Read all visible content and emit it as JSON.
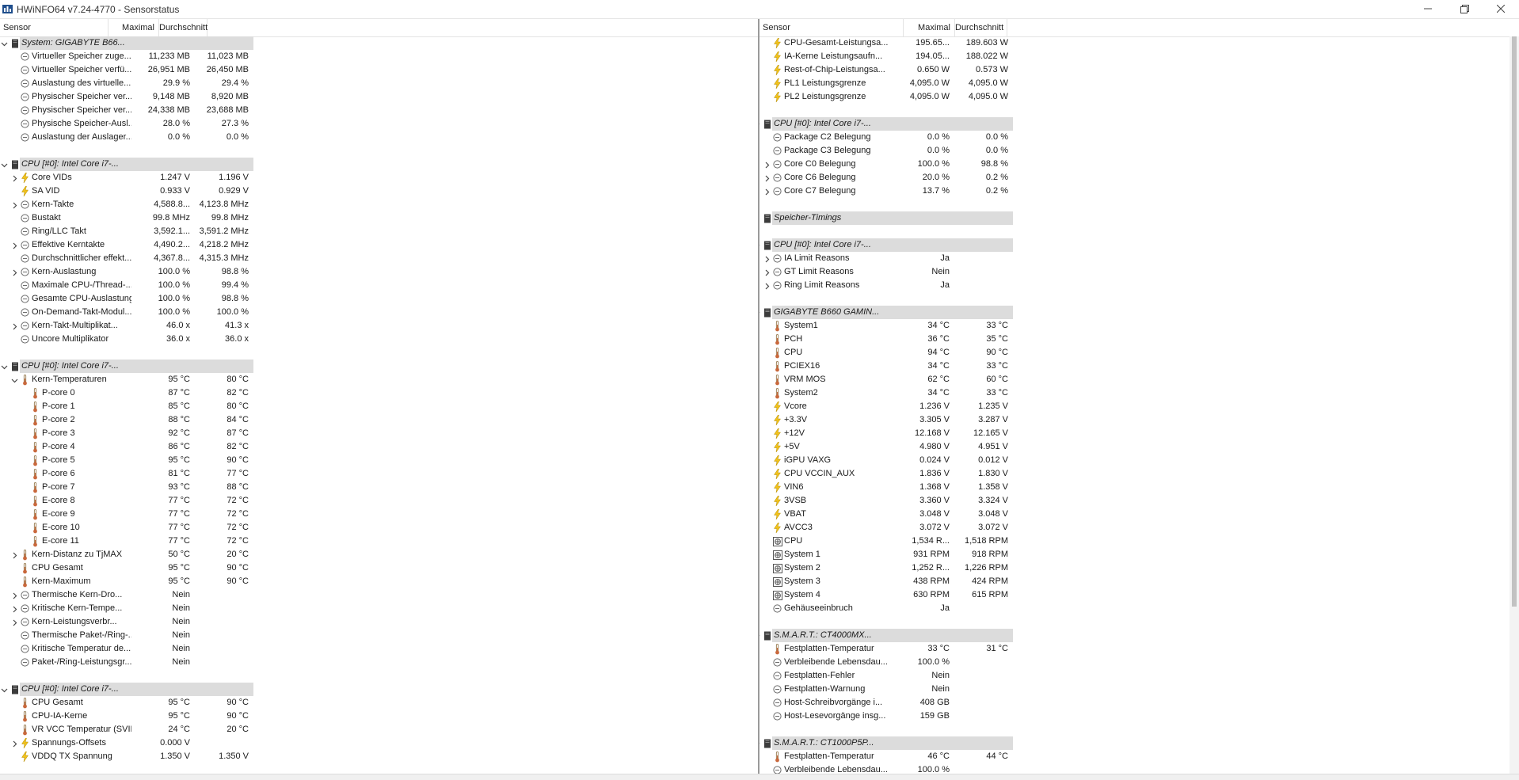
{
  "window": {
    "title": "HWiNFO64 v7.24-4770 - Sensorstatus"
  },
  "columns": {
    "sensor": "Sensor",
    "max": "Maximal",
    "avg": "Durchschnitt"
  },
  "left_rows": [
    {
      "g": 1,
      "e": "v",
      "i": "chip",
      "l": "System: GIGABYTE B66..."
    },
    {
      "d": 1,
      "i": "circle",
      "l": "Virtueller Speicher zuge...",
      "m": "11,233 MB",
      "a": "11,023 MB"
    },
    {
      "d": 1,
      "i": "circle",
      "l": "Virtueller Speicher verfü...",
      "m": "26,951 MB",
      "a": "26,450 MB"
    },
    {
      "d": 1,
      "i": "circle",
      "l": "Auslastung des virtuelle...",
      "m": "29.9 %",
      "a": "29.4 %"
    },
    {
      "d": 1,
      "i": "circle",
      "l": "Physischer Speicher ver...",
      "m": "9,148 MB",
      "a": "8,920 MB"
    },
    {
      "d": 1,
      "i": "circle",
      "l": "Physischer Speicher ver...",
      "m": "24,338 MB",
      "a": "23,688 MB"
    },
    {
      "d": 1,
      "i": "circle",
      "l": "Physische Speicher-Ausl...",
      "m": "28.0 %",
      "a": "27.3 %"
    },
    {
      "d": 1,
      "i": "circle",
      "l": "Auslastung der Auslager...",
      "m": "0.0 %",
      "a": "0.0 %"
    },
    {
      "b": 1
    },
    {
      "g": 1,
      "e": "v",
      "i": "chip",
      "l": "CPU [#0]: Intel Core i7-..."
    },
    {
      "d": 1,
      "e": ">",
      "i": "bolt",
      "l": "Core VIDs",
      "m": "1.247 V",
      "a": "1.196 V"
    },
    {
      "d": 1,
      "i": "bolt",
      "l": "SA VID",
      "m": "0.933 V",
      "a": "0.929 V"
    },
    {
      "d": 1,
      "e": ">",
      "i": "circle",
      "l": "Kern-Takte",
      "m": "4,588.8...",
      "a": "4,123.8 MHz"
    },
    {
      "d": 1,
      "i": "circle",
      "l": "Bustakt",
      "m": "99.8 MHz",
      "a": "99.8 MHz"
    },
    {
      "d": 1,
      "i": "circle",
      "l": "Ring/LLC Takt",
      "m": "3,592.1...",
      "a": "3,591.2 MHz"
    },
    {
      "d": 1,
      "e": ">",
      "i": "circle",
      "l": "Effektive Kerntakte",
      "m": "4,490.2...",
      "a": "4,218.2 MHz"
    },
    {
      "d": 1,
      "i": "circle",
      "l": "Durchschnittlicher effekt...",
      "m": "4,367.8...",
      "a": "4,315.3 MHz"
    },
    {
      "d": 1,
      "e": ">",
      "i": "circle",
      "l": "Kern-Auslastung",
      "m": "100.0 %",
      "a": "98.8 %"
    },
    {
      "d": 1,
      "i": "circle",
      "l": "Maximale CPU-/Thread-...",
      "m": "100.0 %",
      "a": "99.4 %"
    },
    {
      "d": 1,
      "i": "circle",
      "l": "Gesamte CPU-Auslastung",
      "m": "100.0 %",
      "a": "98.8 %"
    },
    {
      "d": 1,
      "i": "circle",
      "l": "On-Demand-Takt-Modul...",
      "m": "100.0 %",
      "a": "100.0 %"
    },
    {
      "d": 1,
      "e": ">",
      "i": "circle",
      "l": "Kern-Takt-Multiplikat...",
      "m": "46.0 x",
      "a": "41.3 x"
    },
    {
      "d": 1,
      "i": "circle",
      "l": "Uncore Multiplikator",
      "m": "36.0 x",
      "a": "36.0 x"
    },
    {
      "b": 1
    },
    {
      "g": 1,
      "e": "v",
      "i": "chip",
      "l": "CPU [#0]: Intel Core i7-..."
    },
    {
      "d": 1,
      "e": "v",
      "i": "therm",
      "l": "Kern-Temperaturen",
      "m": "95 °C",
      "a": "80 °C"
    },
    {
      "d": 2,
      "i": "therm",
      "l": "P-core 0",
      "m": "87 °C",
      "a": "82 °C"
    },
    {
      "d": 2,
      "i": "therm",
      "l": "P-core 1",
      "m": "85 °C",
      "a": "80 °C"
    },
    {
      "d": 2,
      "i": "therm",
      "l": "P-core 2",
      "m": "88 °C",
      "a": "84 °C"
    },
    {
      "d": 2,
      "i": "therm",
      "l": "P-core 3",
      "m": "92 °C",
      "a": "87 °C"
    },
    {
      "d": 2,
      "i": "therm",
      "l": "P-core 4",
      "m": "86 °C",
      "a": "82 °C"
    },
    {
      "d": 2,
      "i": "therm",
      "l": "P-core 5",
      "m": "95 °C",
      "a": "90 °C"
    },
    {
      "d": 2,
      "i": "therm",
      "l": "P-core 6",
      "m": "81 °C",
      "a": "77 °C"
    },
    {
      "d": 2,
      "i": "therm",
      "l": "P-core 7",
      "m": "93 °C",
      "a": "88 °C"
    },
    {
      "d": 2,
      "i": "therm",
      "l": "E-core 8",
      "m": "77 °C",
      "a": "72 °C"
    },
    {
      "d": 2,
      "i": "therm",
      "l": "E-core 9",
      "m": "77 °C",
      "a": "72 °C"
    },
    {
      "d": 2,
      "i": "therm",
      "l": "E-core 10",
      "m": "77 °C",
      "a": "72 °C"
    },
    {
      "d": 2,
      "i": "therm",
      "l": "E-core 11",
      "m": "77 °C",
      "a": "72 °C"
    },
    {
      "d": 1,
      "e": ">",
      "i": "therm",
      "l": "Kern-Distanz zu TjMAX",
      "m": "50 °C",
      "a": "20 °C"
    },
    {
      "d": 1,
      "i": "therm",
      "l": "CPU Gesamt",
      "m": "95 °C",
      "a": "90 °C"
    },
    {
      "d": 1,
      "i": "therm",
      "l": "Kern-Maximum",
      "m": "95 °C",
      "a": "90 °C"
    },
    {
      "d": 1,
      "e": ">",
      "i": "circle",
      "l": "Thermische Kern-Dro...",
      "m": "Nein",
      "a": ""
    },
    {
      "d": 1,
      "e": ">",
      "i": "circle",
      "l": "Kritische Kern-Tempe...",
      "m": "Nein",
      "a": ""
    },
    {
      "d": 1,
      "e": ">",
      "i": "circle",
      "l": "Kern-Leistungsverbr...",
      "m": "Nein",
      "a": ""
    },
    {
      "d": 1,
      "i": "circle",
      "l": "Thermische Paket-/Ring-...",
      "m": "Nein",
      "a": ""
    },
    {
      "d": 1,
      "i": "circle",
      "l": "Kritische Temperatur de...",
      "m": "Nein",
      "a": ""
    },
    {
      "d": 1,
      "i": "circle",
      "l": "Paket-/Ring-Leistungsgr...",
      "m": "Nein",
      "a": ""
    },
    {
      "b": 1
    },
    {
      "g": 1,
      "e": "v",
      "i": "chip",
      "l": "CPU [#0]: Intel Core i7-..."
    },
    {
      "d": 1,
      "i": "therm",
      "l": "CPU Gesamt",
      "m": "95 °C",
      "a": "90 °C"
    },
    {
      "d": 1,
      "i": "therm",
      "l": "CPU-IA-Kerne",
      "m": "95 °C",
      "a": "90 °C"
    },
    {
      "d": 1,
      "i": "therm",
      "l": "VR VCC Temperatur (SVID)",
      "m": "24 °C",
      "a": "20 °C"
    },
    {
      "d": 1,
      "e": ">",
      "i": "bolt",
      "l": "Spannungs-Offsets",
      "m": "0.000 V",
      "a": ""
    },
    {
      "d": 1,
      "i": "bolt",
      "l": "VDDQ TX Spannung",
      "m": "1.350 V",
      "a": "1.350 V"
    }
  ],
  "right_rows": [
    {
      "d": 1,
      "i": "bolt",
      "l": "CPU-Gesamt-Leistungsa...",
      "m": "195.65...",
      "a": "189.603 W"
    },
    {
      "d": 1,
      "i": "bolt",
      "l": "IA-Kerne Leistungsaufn...",
      "m": "194.05...",
      "a": "188.022 W"
    },
    {
      "d": 1,
      "i": "bolt",
      "l": "Rest-of-Chip-Leistungsa...",
      "m": "0.650 W",
      "a": "0.573 W"
    },
    {
      "d": 1,
      "i": "bolt",
      "l": "PL1 Leistungsgrenze",
      "m": "4,095.0 W",
      "a": "4,095.0 W"
    },
    {
      "d": 1,
      "i": "bolt",
      "l": "PL2 Leistungsgrenze",
      "m": "4,095.0 W",
      "a": "4,095.0 W"
    },
    {
      "b": 1
    },
    {
      "g": 1,
      "e": "v",
      "i": "chip",
      "l": "CPU [#0]: Intel Core i7-..."
    },
    {
      "d": 1,
      "i": "circle",
      "l": "Package C2 Belegung",
      "m": "0.0 %",
      "a": "0.0 %"
    },
    {
      "d": 1,
      "i": "circle",
      "l": "Package C3 Belegung",
      "m": "0.0 %",
      "a": "0.0 %"
    },
    {
      "d": 1,
      "e": ">",
      "i": "circle",
      "l": "Core C0 Belegung",
      "m": "100.0 %",
      "a": "98.8 %"
    },
    {
      "d": 1,
      "e": ">",
      "i": "circle",
      "l": "Core C6 Belegung",
      "m": "20.0 %",
      "a": "0.2 %"
    },
    {
      "d": 1,
      "e": ">",
      "i": "circle",
      "l": "Core C7 Belegung",
      "m": "13.7 %",
      "a": "0.2 %"
    },
    {
      "b": 1
    },
    {
      "g": 1,
      "e": ">",
      "i": "chip",
      "l": "Speicher-Timings"
    },
    {
      "b": 1
    },
    {
      "g": 1,
      "e": "v",
      "i": "chip",
      "l": "CPU [#0]: Intel Core i7-..."
    },
    {
      "d": 1,
      "e": ">",
      "i": "circle",
      "l": "IA Limit Reasons",
      "m": "Ja",
      "a": ""
    },
    {
      "d": 1,
      "e": ">",
      "i": "circle",
      "l": "GT Limit Reasons",
      "m": "Nein",
      "a": ""
    },
    {
      "d": 1,
      "e": ">",
      "i": "circle",
      "l": "Ring Limit Reasons",
      "m": "Ja",
      "a": ""
    },
    {
      "b": 1
    },
    {
      "g": 1,
      "e": "v",
      "i": "chip",
      "l": "GIGABYTE B660 GAMIN..."
    },
    {
      "d": 1,
      "i": "therm",
      "l": "System1",
      "m": "34 °C",
      "a": "33 °C"
    },
    {
      "d": 1,
      "i": "therm",
      "l": "PCH",
      "m": "36 °C",
      "a": "35 °C"
    },
    {
      "d": 1,
      "i": "therm",
      "l": "CPU",
      "m": "94 °C",
      "a": "90 °C"
    },
    {
      "d": 1,
      "i": "therm",
      "l": "PCIEX16",
      "m": "34 °C",
      "a": "33 °C"
    },
    {
      "d": 1,
      "i": "therm",
      "l": "VRM MOS",
      "m": "62 °C",
      "a": "60 °C"
    },
    {
      "d": 1,
      "i": "therm",
      "l": "System2",
      "m": "34 °C",
      "a": "33 °C"
    },
    {
      "d": 1,
      "i": "bolt",
      "l": "Vcore",
      "m": "1.236 V",
      "a": "1.235 V"
    },
    {
      "d": 1,
      "i": "bolt",
      "l": "+3.3V",
      "m": "3.305 V",
      "a": "3.287 V"
    },
    {
      "d": 1,
      "i": "bolt",
      "l": "+12V",
      "m": "12.168 V",
      "a": "12.165 V"
    },
    {
      "d": 1,
      "i": "bolt",
      "l": "+5V",
      "m": "4.980 V",
      "a": "4.951 V"
    },
    {
      "d": 1,
      "i": "bolt",
      "l": "iGPU VAXG",
      "m": "0.024 V",
      "a": "0.012 V"
    },
    {
      "d": 1,
      "i": "bolt",
      "l": "CPU VCCIN_AUX",
      "m": "1.836 V",
      "a": "1.830 V"
    },
    {
      "d": 1,
      "i": "bolt",
      "l": "VIN6",
      "m": "1.368 V",
      "a": "1.358 V"
    },
    {
      "d": 1,
      "i": "bolt",
      "l": "3VSB",
      "m": "3.360 V",
      "a": "3.324 V"
    },
    {
      "d": 1,
      "i": "bolt",
      "l": "VBAT",
      "m": "3.048 V",
      "a": "3.048 V"
    },
    {
      "d": 1,
      "i": "bolt",
      "l": "AVCC3",
      "m": "3.072 V",
      "a": "3.072 V"
    },
    {
      "d": 1,
      "i": "fan",
      "l": "CPU",
      "m": "1,534 R...",
      "a": "1,518 RPM"
    },
    {
      "d": 1,
      "i": "fan",
      "l": "System 1",
      "m": "931 RPM",
      "a": "918 RPM"
    },
    {
      "d": 1,
      "i": "fan",
      "l": "System 2",
      "m": "1,252 R...",
      "a": "1,226 RPM"
    },
    {
      "d": 1,
      "i": "fan",
      "l": "System 3",
      "m": "438 RPM",
      "a": "424 RPM"
    },
    {
      "d": 1,
      "i": "fan",
      "l": "System 4",
      "m": "630 RPM",
      "a": "615 RPM"
    },
    {
      "d": 1,
      "i": "circle",
      "l": "Gehäuseeinbruch",
      "m": "Ja",
      "a": ""
    },
    {
      "b": 1
    },
    {
      "g": 1,
      "e": "v",
      "i": "chip",
      "l": "S.M.A.R.T.: CT4000MX..."
    },
    {
      "d": 1,
      "i": "therm",
      "l": "Festplatten-Temperatur",
      "m": "33 °C",
      "a": "31 °C"
    },
    {
      "d": 1,
      "i": "circle",
      "l": "Verbleibende Lebensdau...",
      "m": "100.0 %",
      "a": ""
    },
    {
      "d": 1,
      "i": "circle",
      "l": "Festplatten-Fehler",
      "m": "Nein",
      "a": ""
    },
    {
      "d": 1,
      "i": "circle",
      "l": "Festplatten-Warnung",
      "m": "Nein",
      "a": ""
    },
    {
      "d": 1,
      "i": "circle",
      "l": "Host-Schreibvorgänge i...",
      "m": "408 GB",
      "a": ""
    },
    {
      "d": 1,
      "i": "circle",
      "l": "Host-Lesevorgänge insg...",
      "m": "159 GB",
      "a": ""
    },
    {
      "b": 1
    },
    {
      "g": 1,
      "e": "v",
      "i": "chip",
      "l": "S.M.A.R.T.: CT1000P5P..."
    },
    {
      "d": 1,
      "i": "therm",
      "l": "Festplatten-Temperatur",
      "m": "46 °C",
      "a": "44 °C"
    },
    {
      "d": 1,
      "i": "circle",
      "l": "Verbleibende Lebensdau...",
      "m": "100.0 %",
      "a": ""
    }
  ]
}
